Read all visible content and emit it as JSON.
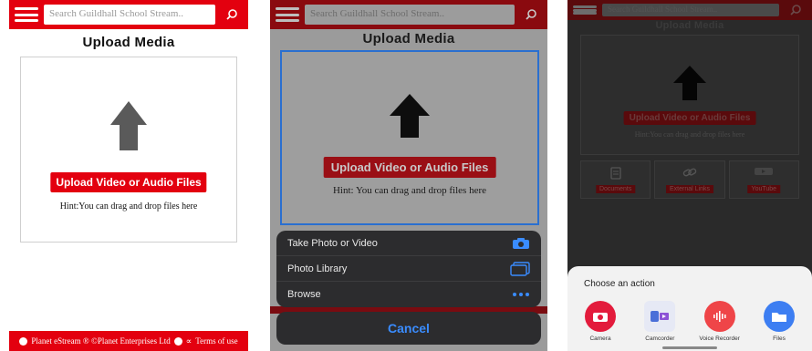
{
  "search_placeholder": "Search Guildhall School Stream..",
  "upload": {
    "title": "Upload Media",
    "button_label": "Upload Video or Audio Files",
    "hint": "Hint: You can drag and drop files here",
    "hint_compact": "Hint:You can drag and drop files here"
  },
  "footer": {
    "copyright": "Planet eStream ® ©Planet Enterprises Ltd",
    "terms": "Terms of use"
  },
  "ios_sheet": {
    "items": [
      {
        "label": "Take Photo or Video",
        "icon": "camera-icon"
      },
      {
        "label": "Photo Library",
        "icon": "photo-library-icon"
      },
      {
        "label": "Browse",
        "icon": "more-icon"
      }
    ],
    "cancel_label": "Cancel"
  },
  "android": {
    "tiles": [
      {
        "label": "Documents",
        "icon": "document-icon"
      },
      {
        "label": "External Links",
        "icon": "link-icon"
      },
      {
        "label": "YouTube",
        "icon": "youtube-icon"
      }
    ],
    "chooser_title": "Choose an action",
    "apps": [
      {
        "label": "Camera",
        "icon": "camera-app-icon",
        "color": "#e31b3c"
      },
      {
        "label": "Camcorder",
        "icon": "camcorder-app-icon",
        "color": "#e6e9f5"
      },
      {
        "label": "Voice Recorder",
        "icon": "voice-recorder-app-icon",
        "color": "#ef4548"
      },
      {
        "label": "Files",
        "icon": "files-app-icon",
        "color": "#3d7ef2"
      }
    ]
  },
  "colors": {
    "brand_red": "#e3000f",
    "ios_blue": "#3a8cff"
  }
}
